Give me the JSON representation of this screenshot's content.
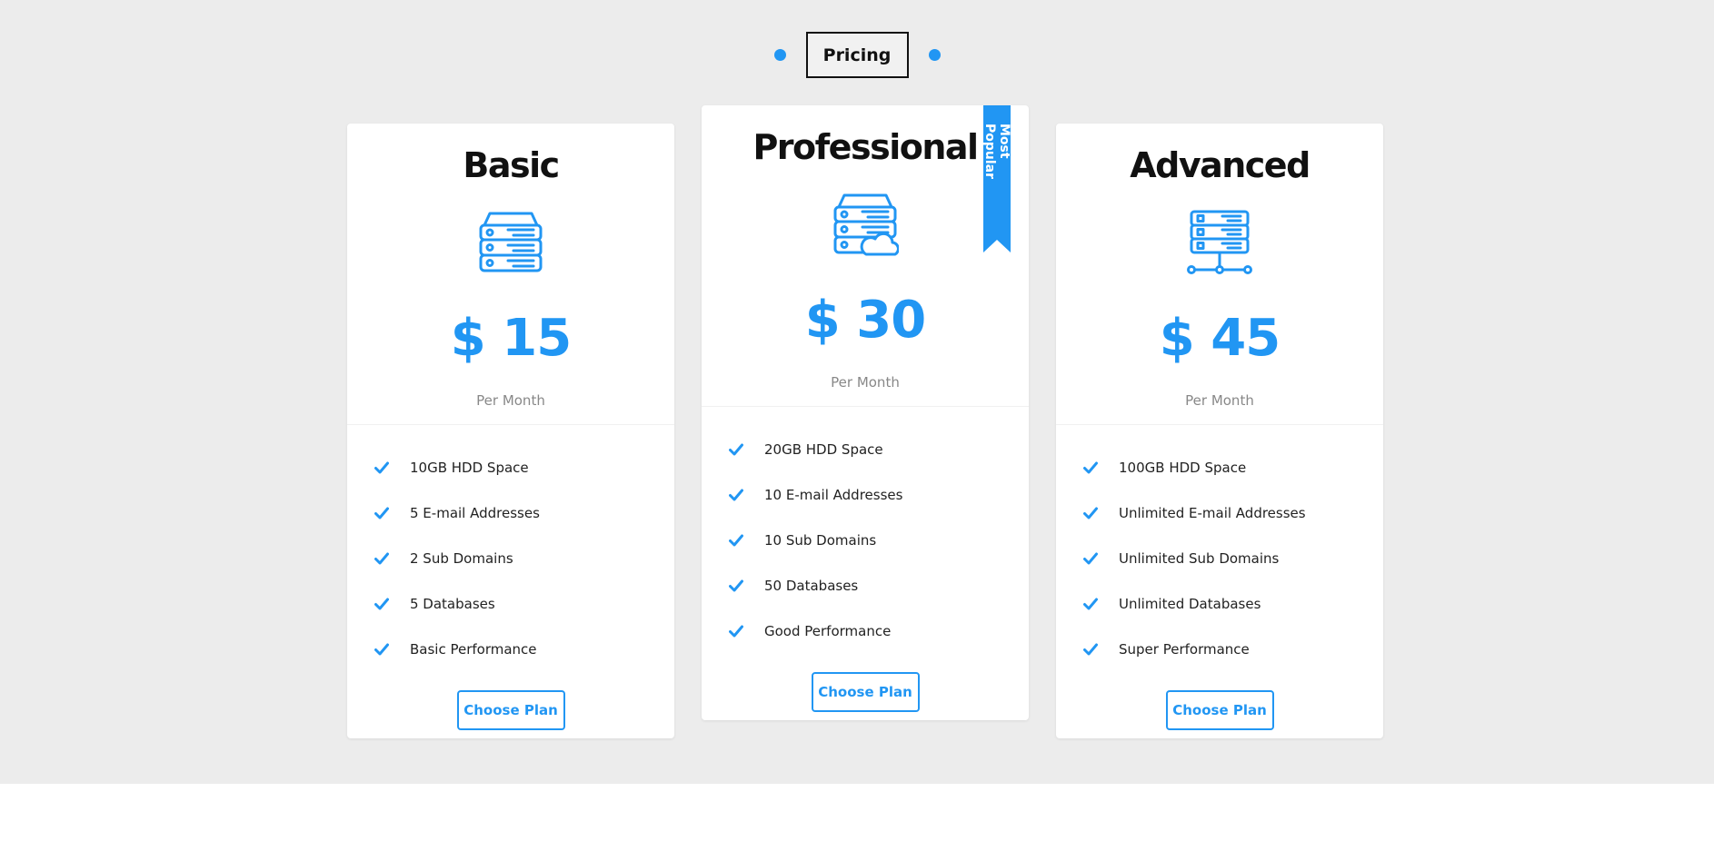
{
  "section": {
    "title": "Pricing",
    "accent_color": "#2196f3"
  },
  "plans": [
    {
      "name": "Basic",
      "icon": "server-stack-icon",
      "price": "$ 15",
      "period": "Per Month",
      "features": [
        "10GB HDD Space",
        "5 E-mail Addresses",
        "2 Sub Domains",
        "5 Databases",
        "Basic Performance"
      ],
      "button_label": "Choose Plan"
    },
    {
      "name": "Professional",
      "icon": "cloud-server-icon",
      "price": "$ 30",
      "period": "Per Month",
      "badge": "Most Popular",
      "features": [
        "20GB HDD Space",
        "10 E-mail Addresses",
        "10 Sub Domains",
        "50 Databases",
        "Good Performance"
      ],
      "button_label": "Choose Plan"
    },
    {
      "name": "Advanced",
      "icon": "network-server-icon",
      "price": "$ 45",
      "period": "Per Month",
      "features": [
        "100GB HDD Space",
        "Unlimited E-mail Addresses",
        "Unlimited Sub Domains",
        "Unlimited Databases",
        "Super Performance"
      ],
      "button_label": "Choose Plan"
    }
  ]
}
